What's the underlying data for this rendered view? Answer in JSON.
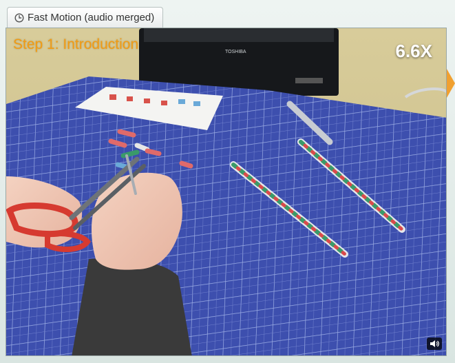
{
  "tab": {
    "label": "Fast Motion (audio merged)",
    "icon": "clock-icon"
  },
  "video": {
    "step_title": "Step 1: Introduction",
    "speed_label": "6.6X",
    "tv_brand": "TOSHIBA",
    "volume_icon": "speaker-icon"
  },
  "colors": {
    "step_title": "#f39c12",
    "speed_label": "#ffffff",
    "cutting_mat": "#3b4cad",
    "next_arrow": "#f0a030"
  }
}
